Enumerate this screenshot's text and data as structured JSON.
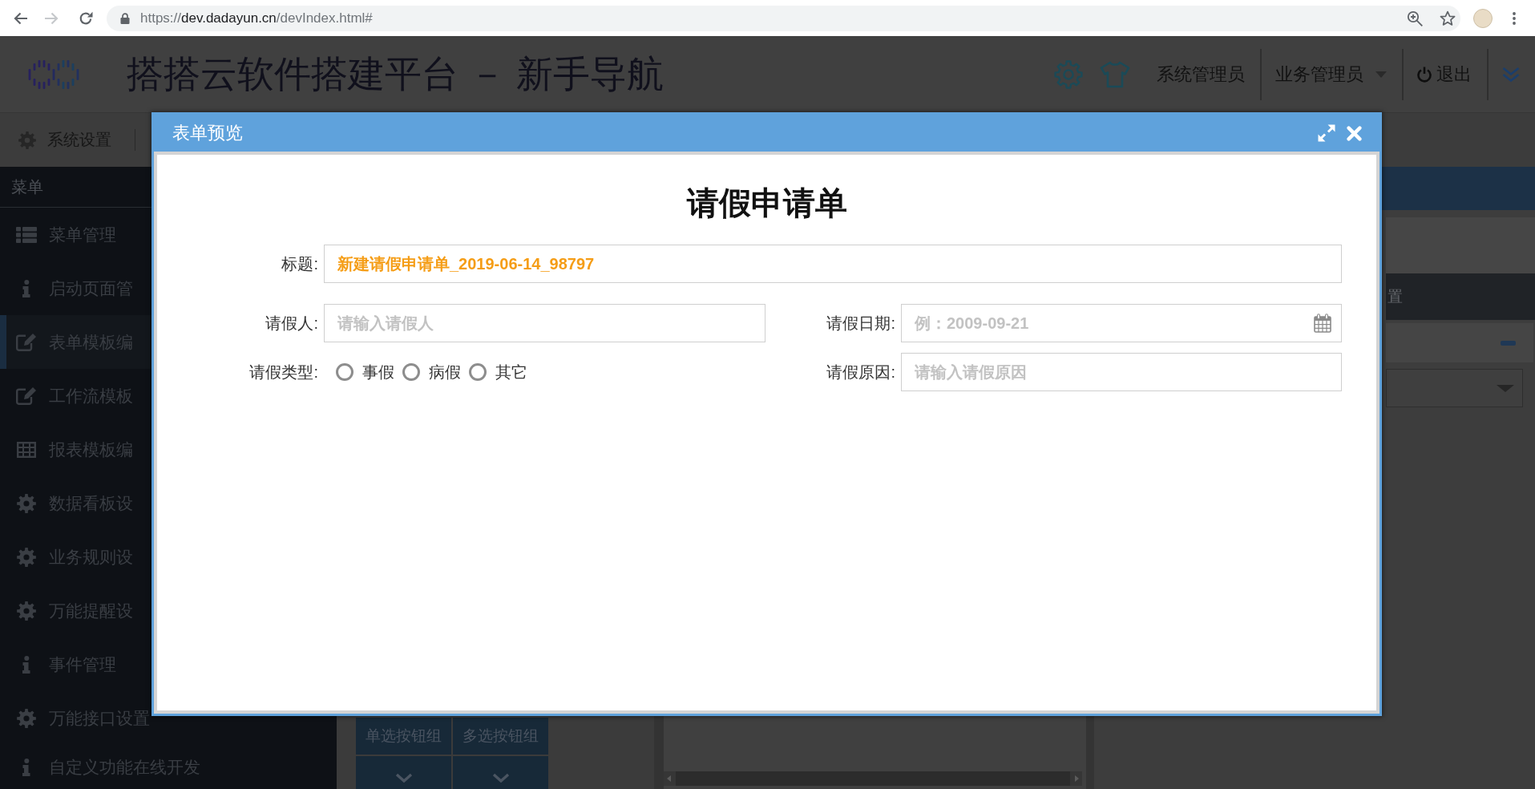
{
  "browser": {
    "nav_buttons": [
      {
        "kind": "back",
        "disabled": false
      },
      {
        "kind": "forward",
        "disabled": true
      },
      {
        "kind": "reload",
        "disabled": false
      }
    ],
    "url": {
      "scheme": "https://",
      "host": "dev.dadayun.cn",
      "path": "/devIndex.html#"
    }
  },
  "header": {
    "title": "搭搭云软件搭建平台 － 新手导航",
    "links": [
      {
        "kind": "text",
        "label": "系统管理员"
      },
      {
        "kind": "dropdown",
        "label": "业务管理员"
      },
      {
        "kind": "logout",
        "label": "退出"
      }
    ]
  },
  "toolbar": {
    "items": [
      {
        "label": "系统设置"
      }
    ]
  },
  "sidebar": {
    "title": "菜单",
    "items": [
      {
        "kind": "list",
        "label": "菜单管理",
        "selected": false
      },
      {
        "kind": "info",
        "label": "启动页面管",
        "selected": false
      },
      {
        "kind": "edit",
        "label": "表单模板编",
        "selected": true
      },
      {
        "kind": "edit",
        "label": "工作流模板",
        "selected": false
      },
      {
        "kind": "table",
        "label": "报表模板编",
        "selected": false
      },
      {
        "kind": "gear",
        "label": "数据看板设",
        "selected": false
      },
      {
        "kind": "gear",
        "label": "业务规则设",
        "selected": false
      },
      {
        "kind": "gear",
        "label": "万能提醒设",
        "selected": false
      },
      {
        "kind": "info",
        "label": "事件管理",
        "selected": false
      },
      {
        "kind": "gear",
        "label": "万能接口设置",
        "selected": false
      },
      {
        "kind": "info",
        "label": "自定义功能在线开发",
        "selected": false
      }
    ]
  },
  "palette": {
    "items": [
      {
        "kind": "label",
        "label": "单选按钮组"
      },
      {
        "kind": "label",
        "label": "多选按钮组"
      },
      {
        "kind": "expand"
      },
      {
        "kind": "expand"
      }
    ]
  },
  "properties": {
    "heading": "置"
  },
  "modal": {
    "title": "表单预览",
    "form": {
      "title": "请假申请单",
      "rows": [
        [
          {
            "kind": "text",
            "label": "标题:",
            "value": "新建请假申请单_2019-06-14_98797"
          }
        ],
        [
          {
            "kind": "text",
            "label": "请假人:",
            "placeholder": "请输入请假人"
          },
          {
            "kind": "date",
            "label": "请假日期:",
            "placeholder": "例：2009-09-21"
          }
        ],
        [
          {
            "kind": "radio",
            "label": "请假类型:",
            "options": [
              {
                "label": "事假",
                "selected": false
              },
              {
                "label": "病假",
                "selected": false
              },
              {
                "label": "其它",
                "selected": false
              }
            ]
          },
          {
            "kind": "text",
            "label": "请假原因:",
            "placeholder": "请输入请假原因"
          }
        ]
      ]
    }
  }
}
